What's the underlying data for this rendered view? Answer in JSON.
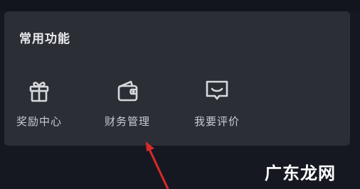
{
  "section": {
    "title": "常用功能"
  },
  "items": [
    {
      "label": "奖励中心",
      "icon": "gift-icon"
    },
    {
      "label": "财务管理",
      "icon": "wallet-icon"
    },
    {
      "label": "我要评价",
      "icon": "chat-review-icon"
    }
  ],
  "watermark": {
    "text": "广东龙网"
  },
  "colors": {
    "background": "#161821",
    "card": "#2b2e35",
    "title": "#e9eaee",
    "label": "#c9cbd2",
    "icon": "#d6d8de",
    "arrow": "#d82a2a"
  }
}
